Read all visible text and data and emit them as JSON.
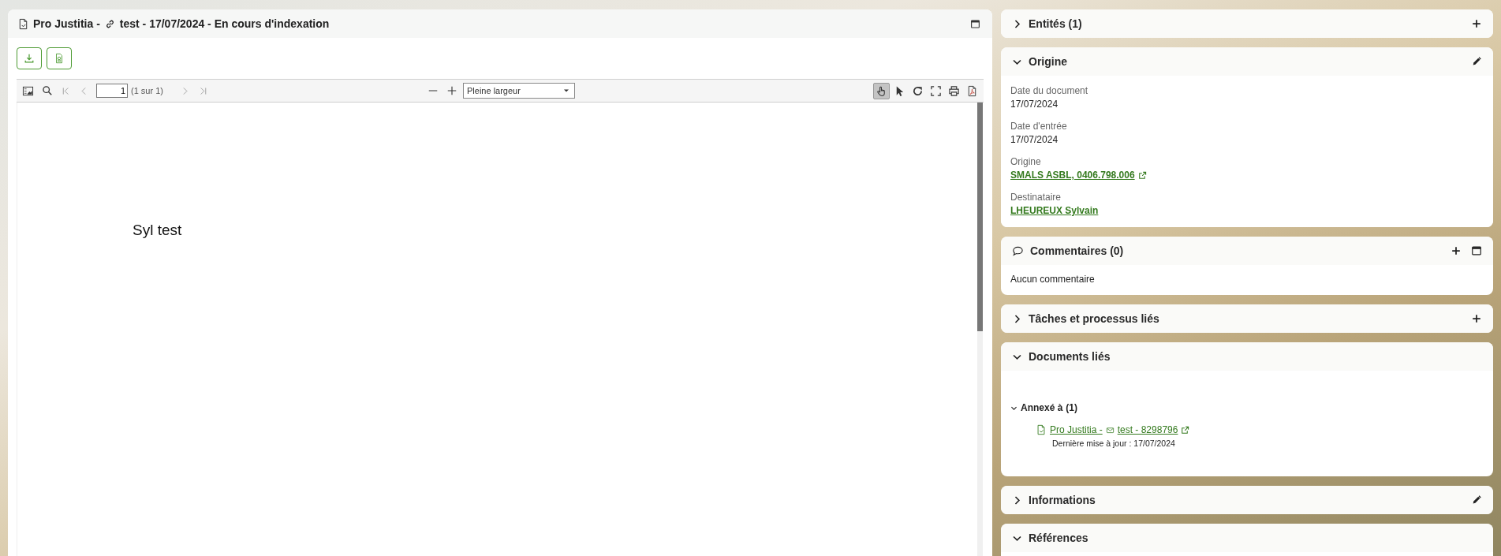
{
  "document": {
    "title_prefix": "Pro Justitia -",
    "title": "test - 17/07/2024 - En cours d'indexation"
  },
  "viewer": {
    "nav": [
      {
        "kind": "first",
        "disabled": true
      },
      {
        "kind": "previous",
        "disabled": true
      },
      {
        "kind": "next",
        "disabled": true
      },
      {
        "kind": "last",
        "disabled": true
      }
    ],
    "page": "1",
    "page_count": "(1 sur 1)",
    "zoom": "Pleine largeur",
    "tools": [
      {
        "kind": "hand",
        "selected": true
      },
      {
        "kind": "pointer",
        "selected": false
      }
    ],
    "actions": [
      {
        "kind": "rotate"
      },
      {
        "kind": "fullscreen"
      },
      {
        "kind": "print"
      },
      {
        "kind": "pdf"
      }
    ],
    "page_text": "Syl test"
  },
  "sections": [
    {
      "kind": "plain",
      "title": "Entités (1)",
      "expanded": false,
      "actions": [
        {
          "kind": "add"
        }
      ]
    },
    {
      "kind": "fields",
      "title": "Origine",
      "expanded": true,
      "actions": [
        {
          "kind": "edit"
        }
      ],
      "fields": [
        {
          "label": "Date du document",
          "value": "17/07/2024",
          "link": false,
          "external": false
        },
        {
          "label": "Date d'entrée",
          "value": "17/07/2024",
          "link": false,
          "external": false
        },
        {
          "label": "Origine",
          "value": "SMALS ASBL, 0406.798.006",
          "link": true,
          "external": true
        },
        {
          "label": "Destinataire",
          "value": "LHEUREUX Sylvain",
          "link": true,
          "external": false
        }
      ]
    },
    {
      "kind": "comments",
      "title": "Commentaires (0)",
      "actions": [
        {
          "kind": "add"
        },
        {
          "kind": "maximize"
        }
      ],
      "text": "Aucun commentaire"
    },
    {
      "kind": "plain",
      "title": "Tâches et processus liés",
      "expanded": false,
      "actions": [
        {
          "kind": "add"
        }
      ]
    },
    {
      "kind": "links",
      "title": "Documents liés",
      "expanded": true,
      "groups": [
        {
          "title": "Annexé à",
          "count": "(1)",
          "expanded": true,
          "items": [
            {
              "title_prefix": "Pro Justitia -",
              "title": "test - 8298796",
              "updated": "Dernière mise à jour : 17/07/2024"
            }
          ]
        }
      ]
    },
    {
      "kind": "plain",
      "title": "Informations",
      "expanded": false,
      "actions": [
        {
          "kind": "edit"
        }
      ]
    },
    {
      "kind": "plain",
      "title": "Références",
      "expanded": true
    }
  ]
}
